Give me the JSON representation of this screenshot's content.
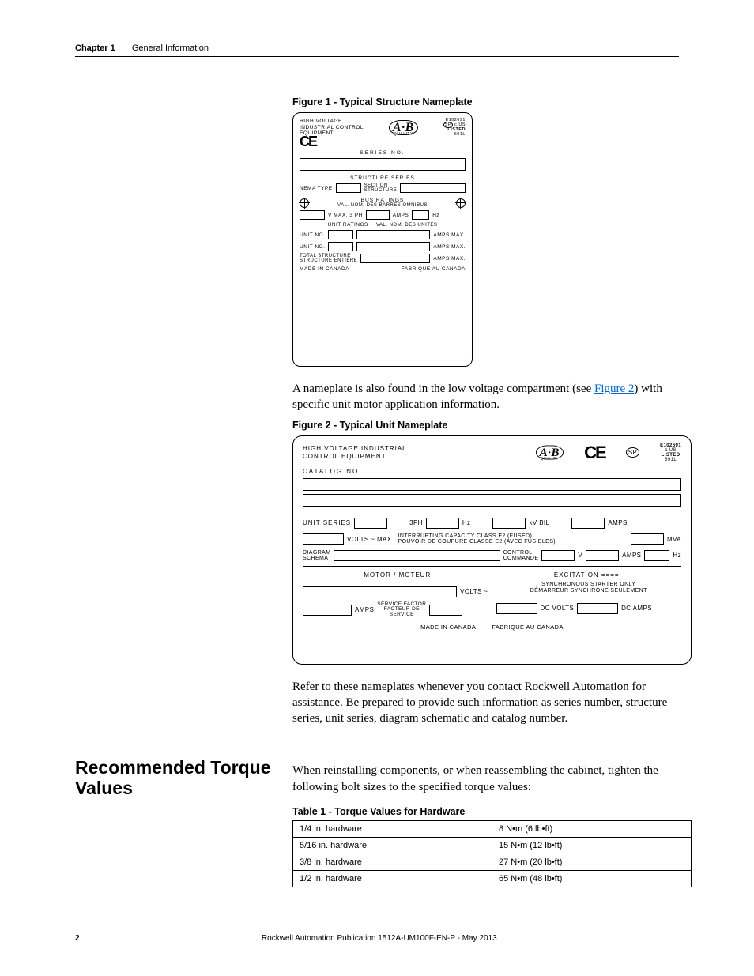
{
  "header": {
    "chapter": "Chapter 1",
    "section": "General Information"
  },
  "figure1": {
    "caption": "Figure 1 - Typical Structure Nameplate",
    "top_label": "HIGH VOLTAGE\nINDUSTRIAL CONTROL\nEQUIPMENT",
    "ab": "A·B",
    "quality": "QUALITY",
    "e_number": "E102691",
    "sp": "SP",
    "c_us": "c US",
    "listed": "LISTED",
    "listed_num": "691L",
    "ce": "CE",
    "series_no": "SERIES NO.",
    "structure_series": "STRUCTURE SERIES",
    "nema_type": "NEMA TYPE",
    "section_structure": "SECTION\nSTRUCTURE",
    "bus_ratings": "BUS RATINGS",
    "bus_ratings_fr": "VAL. NOM. DES BARRES OMNIBUS",
    "vmax3ph": "V MAX. 3 PH",
    "amps": "AMPS",
    "hz": "Hz",
    "unit_ratings": "UNIT RATINGS",
    "unit_ratings_fr": "VAL. NOM. DES UNITÉS",
    "unit_no": "UNIT NO.",
    "amps_max": "AMPS MAX.",
    "total_structure": "TOTAL STRUCTURE",
    "total_structure_fr": "STRUCTURE ENTIÈRE",
    "made_in": "MADE IN CANADA",
    "made_in_fr": "FABRIQUÉ AU CANADA"
  },
  "para1": {
    "before": "A nameplate is also found in the low voltage compartment (see ",
    "link": "Figure 2",
    "after": ") with specific unit motor application information."
  },
  "figure2": {
    "caption": "Figure 2 - Typical Unit Nameplate",
    "top_label": "HIGH VOLTAGE INDUSTRIAL\nCONTROL EQUIPMENT",
    "ab": "A·B",
    "quality": "QUALITY",
    "ce": "CE",
    "sp": "SP",
    "e_number": "E102691",
    "c_us": "c US",
    "listed": "LISTED",
    "listed_num": "691L",
    "catalog_no": "CATALOG NO.",
    "unit_series": "UNIT SERIES",
    "three_ph": "3PH",
    "hz": "Hz",
    "kv_bil": "kV BIL",
    "amps": "AMPS",
    "volts_max": "VOLTS ~ MAX",
    "interrupt_en": "INTERRUPTING CAPACITY CLASS E2 (FUSED)",
    "interrupt_fr": "POUVOIR DE COUPURE CLASSE E2 (AVEC FUSIBLES)",
    "mva": "MVA",
    "diagram": "DIAGRAM",
    "schema": "SCHEMA",
    "control": "CONTROL",
    "commande": "COMMANDE",
    "v": "V",
    "motor": "MOTOR / MOTEUR",
    "excitation": "EXCITATION ====",
    "volts_tilde": "VOLTS ~",
    "sync_en": "SYNCHRONOUS STARTER ONLY",
    "sync_fr": "DÉMARREUR SYNCHRONE SEULEMENT",
    "service_factor": "SERVICE FACTOR",
    "facteur_de": "FACTEUR DE",
    "service": "SERVICE",
    "dc_volts": "DC VOLTS",
    "dc_amps": "DC AMPS",
    "made_in": "MADE IN CANADA",
    "made_in_fr": "FABRIQUÉ AU CANADA"
  },
  "para2": "Refer to these nameplates whenever you contact Rockwell Automation for assistance. Be prepared to provide such information as series number, structure series, unit series, diagram schematic and catalog number.",
  "section2": {
    "heading": "Recommended Torque Values",
    "intro": "When reinstalling components, or when reassembling the cabinet, tighten the following bolt sizes to the specified torque values:"
  },
  "table1": {
    "caption": "Table 1 - Torque Values for Hardware",
    "rows": [
      {
        "hw": "1/4 in. hardware",
        "val": "8 N•m (6 lb•ft)"
      },
      {
        "hw": "5/16 in. hardware",
        "val": "15 N•m (12 lb•ft)"
      },
      {
        "hw": "3/8 in. hardware",
        "val": "27 N•m (20 lb•ft)"
      },
      {
        "hw": "1/2 in. hardware",
        "val": "65 N•m (48 lb•ft)"
      }
    ]
  },
  "footer": {
    "page": "2",
    "pub": "Rockwell Automation Publication 1512A-UM100F-EN-P - May 2013"
  }
}
